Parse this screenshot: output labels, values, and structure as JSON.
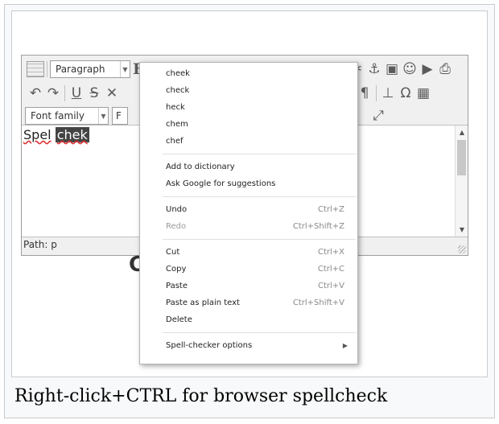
{
  "toolbar": {
    "block_format": "Paragraph",
    "font_family": "Font family",
    "font_size_partial": "F"
  },
  "editor": {
    "text_correct": "Spel",
    "text_misspelled": "chek",
    "path": "Path: p",
    "behind_menu_char": "C"
  },
  "context_menu": {
    "suggestions": [
      "cheek",
      "check",
      "heck",
      "chem",
      "chef"
    ],
    "add_to_dictionary": "Add to dictionary",
    "ask_google": "Ask Google for suggestions",
    "undo": {
      "label": "Undo",
      "shortcut": "Ctrl+Z"
    },
    "redo": {
      "label": "Redo",
      "shortcut": "Ctrl+Shift+Z"
    },
    "cut": {
      "label": "Cut",
      "shortcut": "Ctrl+X"
    },
    "copy": {
      "label": "Copy",
      "shortcut": "Ctrl+C"
    },
    "paste": {
      "label": "Paste",
      "shortcut": "Ctrl+V"
    },
    "paste_plain": {
      "label": "Paste as plain text",
      "shortcut": "Ctrl+Shift+V"
    },
    "delete": "Delete",
    "spell_options": "Spell-checker options"
  },
  "caption": "Right-click+CTRL for browser spellcheck"
}
